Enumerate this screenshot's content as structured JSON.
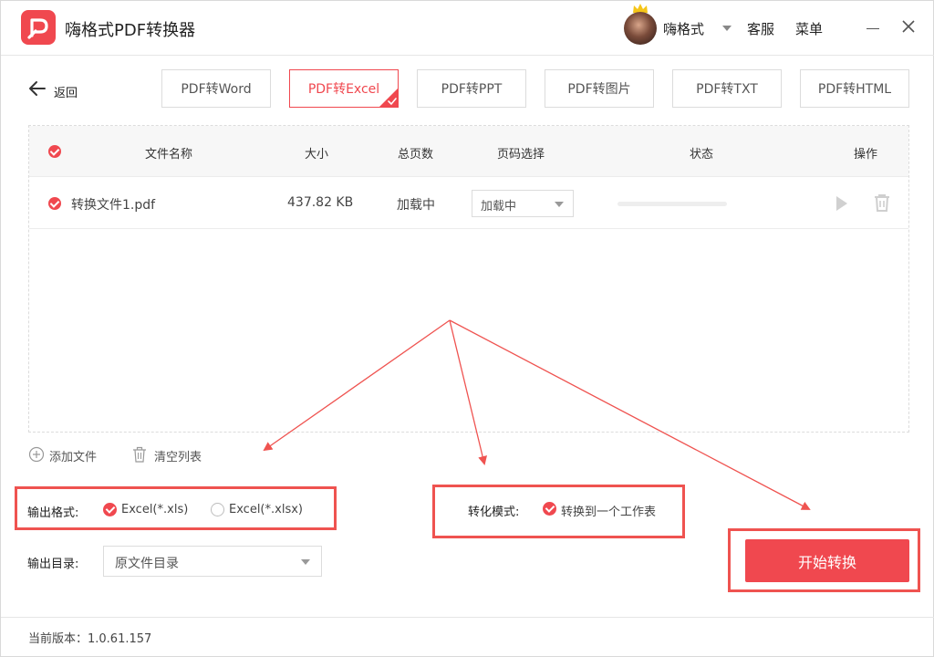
{
  "app": {
    "title": "嗨格式PDF转换器"
  },
  "header": {
    "username": "嗨格式",
    "service": "客服",
    "menu": "菜单"
  },
  "nav": {
    "back_label": "返回"
  },
  "tabs": [
    {
      "label": "PDF转Word",
      "active": false
    },
    {
      "label": "PDF转Excel",
      "active": true
    },
    {
      "label": "PDF转PPT",
      "active": false
    },
    {
      "label": "PDF转图片",
      "active": false
    },
    {
      "label": "PDF转TXT",
      "active": false
    },
    {
      "label": "PDF转HTML",
      "active": false
    }
  ],
  "table": {
    "columns": [
      "文件名称",
      "大小",
      "总页数",
      "页码选择",
      "状态",
      "操作"
    ],
    "rows": [
      {
        "filename": "转换文件1.pdf",
        "size": "437.82 KB",
        "pages": "加载中",
        "page_select": "加载中",
        "progress": 0
      }
    ]
  },
  "list_actions": {
    "add_file": "添加文件",
    "clear_list": "清空列表"
  },
  "output_format": {
    "label": "输出格式:",
    "options": [
      {
        "label": "Excel(*.xls)",
        "selected": true
      },
      {
        "label": "Excel(*.xlsx)",
        "selected": false
      }
    ]
  },
  "conversion_mode": {
    "label": "转化模式:",
    "option": {
      "label": "转换到一个工作表",
      "selected": true
    }
  },
  "output_dir": {
    "label": "输出目录:",
    "value": "原文件目录"
  },
  "start_button": "开始转换",
  "footer": {
    "version": "当前版本：1.0.61.157"
  },
  "colors": {
    "accent": "#f0484f",
    "annotation": "#ef5350"
  },
  "icons": [
    "app-logo-icon",
    "crown-icon",
    "back-arrow-icon",
    "check-corner-icon",
    "play-icon",
    "trash-icon",
    "add-circle-icon",
    "close-icon"
  ]
}
